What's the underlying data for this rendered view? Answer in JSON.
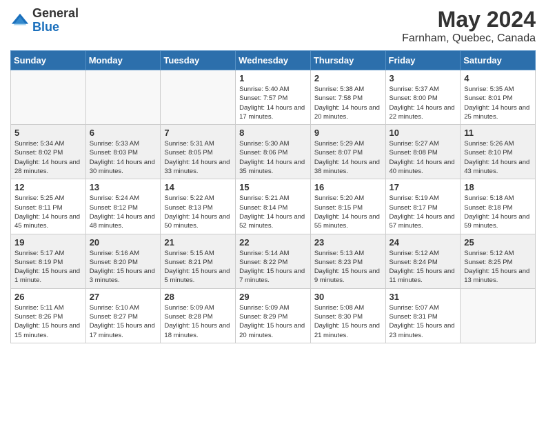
{
  "header": {
    "logo_general": "General",
    "logo_blue": "Blue",
    "title": "May 2024",
    "subtitle": "Farnham, Quebec, Canada"
  },
  "days_of_week": [
    "Sunday",
    "Monday",
    "Tuesday",
    "Wednesday",
    "Thursday",
    "Friday",
    "Saturday"
  ],
  "weeks": [
    {
      "days": [
        {
          "number": "",
          "sunrise": "",
          "sunset": "",
          "daylight": "",
          "empty": true
        },
        {
          "number": "",
          "sunrise": "",
          "sunset": "",
          "daylight": "",
          "empty": true
        },
        {
          "number": "",
          "sunrise": "",
          "sunset": "",
          "daylight": "",
          "empty": true
        },
        {
          "number": "1",
          "sunrise": "Sunrise: 5:40 AM",
          "sunset": "Sunset: 7:57 PM",
          "daylight": "Daylight: 14 hours and 17 minutes."
        },
        {
          "number": "2",
          "sunrise": "Sunrise: 5:38 AM",
          "sunset": "Sunset: 7:58 PM",
          "daylight": "Daylight: 14 hours and 20 minutes."
        },
        {
          "number": "3",
          "sunrise": "Sunrise: 5:37 AM",
          "sunset": "Sunset: 8:00 PM",
          "daylight": "Daylight: 14 hours and 22 minutes."
        },
        {
          "number": "4",
          "sunrise": "Sunrise: 5:35 AM",
          "sunset": "Sunset: 8:01 PM",
          "daylight": "Daylight: 14 hours and 25 minutes."
        }
      ]
    },
    {
      "days": [
        {
          "number": "5",
          "sunrise": "Sunrise: 5:34 AM",
          "sunset": "Sunset: 8:02 PM",
          "daylight": "Daylight: 14 hours and 28 minutes."
        },
        {
          "number": "6",
          "sunrise": "Sunrise: 5:33 AM",
          "sunset": "Sunset: 8:03 PM",
          "daylight": "Daylight: 14 hours and 30 minutes."
        },
        {
          "number": "7",
          "sunrise": "Sunrise: 5:31 AM",
          "sunset": "Sunset: 8:05 PM",
          "daylight": "Daylight: 14 hours and 33 minutes."
        },
        {
          "number": "8",
          "sunrise": "Sunrise: 5:30 AM",
          "sunset": "Sunset: 8:06 PM",
          "daylight": "Daylight: 14 hours and 35 minutes."
        },
        {
          "number": "9",
          "sunrise": "Sunrise: 5:29 AM",
          "sunset": "Sunset: 8:07 PM",
          "daylight": "Daylight: 14 hours and 38 minutes."
        },
        {
          "number": "10",
          "sunrise": "Sunrise: 5:27 AM",
          "sunset": "Sunset: 8:08 PM",
          "daylight": "Daylight: 14 hours and 40 minutes."
        },
        {
          "number": "11",
          "sunrise": "Sunrise: 5:26 AM",
          "sunset": "Sunset: 8:10 PM",
          "daylight": "Daylight: 14 hours and 43 minutes."
        }
      ]
    },
    {
      "days": [
        {
          "number": "12",
          "sunrise": "Sunrise: 5:25 AM",
          "sunset": "Sunset: 8:11 PM",
          "daylight": "Daylight: 14 hours and 45 minutes."
        },
        {
          "number": "13",
          "sunrise": "Sunrise: 5:24 AM",
          "sunset": "Sunset: 8:12 PM",
          "daylight": "Daylight: 14 hours and 48 minutes."
        },
        {
          "number": "14",
          "sunrise": "Sunrise: 5:22 AM",
          "sunset": "Sunset: 8:13 PM",
          "daylight": "Daylight: 14 hours and 50 minutes."
        },
        {
          "number": "15",
          "sunrise": "Sunrise: 5:21 AM",
          "sunset": "Sunset: 8:14 PM",
          "daylight": "Daylight: 14 hours and 52 minutes."
        },
        {
          "number": "16",
          "sunrise": "Sunrise: 5:20 AM",
          "sunset": "Sunset: 8:15 PM",
          "daylight": "Daylight: 14 hours and 55 minutes."
        },
        {
          "number": "17",
          "sunrise": "Sunrise: 5:19 AM",
          "sunset": "Sunset: 8:17 PM",
          "daylight": "Daylight: 14 hours and 57 minutes."
        },
        {
          "number": "18",
          "sunrise": "Sunrise: 5:18 AM",
          "sunset": "Sunset: 8:18 PM",
          "daylight": "Daylight: 14 hours and 59 minutes."
        }
      ]
    },
    {
      "days": [
        {
          "number": "19",
          "sunrise": "Sunrise: 5:17 AM",
          "sunset": "Sunset: 8:19 PM",
          "daylight": "Daylight: 15 hours and 1 minute."
        },
        {
          "number": "20",
          "sunrise": "Sunrise: 5:16 AM",
          "sunset": "Sunset: 8:20 PM",
          "daylight": "Daylight: 15 hours and 3 minutes."
        },
        {
          "number": "21",
          "sunrise": "Sunrise: 5:15 AM",
          "sunset": "Sunset: 8:21 PM",
          "daylight": "Daylight: 15 hours and 5 minutes."
        },
        {
          "number": "22",
          "sunrise": "Sunrise: 5:14 AM",
          "sunset": "Sunset: 8:22 PM",
          "daylight": "Daylight: 15 hours and 7 minutes."
        },
        {
          "number": "23",
          "sunrise": "Sunrise: 5:13 AM",
          "sunset": "Sunset: 8:23 PM",
          "daylight": "Daylight: 15 hours and 9 minutes."
        },
        {
          "number": "24",
          "sunrise": "Sunrise: 5:12 AM",
          "sunset": "Sunset: 8:24 PM",
          "daylight": "Daylight: 15 hours and 11 minutes."
        },
        {
          "number": "25",
          "sunrise": "Sunrise: 5:12 AM",
          "sunset": "Sunset: 8:25 PM",
          "daylight": "Daylight: 15 hours and 13 minutes."
        }
      ]
    },
    {
      "days": [
        {
          "number": "26",
          "sunrise": "Sunrise: 5:11 AM",
          "sunset": "Sunset: 8:26 PM",
          "daylight": "Daylight: 15 hours and 15 minutes."
        },
        {
          "number": "27",
          "sunrise": "Sunrise: 5:10 AM",
          "sunset": "Sunset: 8:27 PM",
          "daylight": "Daylight: 15 hours and 17 minutes."
        },
        {
          "number": "28",
          "sunrise": "Sunrise: 5:09 AM",
          "sunset": "Sunset: 8:28 PM",
          "daylight": "Daylight: 15 hours and 18 minutes."
        },
        {
          "number": "29",
          "sunrise": "Sunrise: 5:09 AM",
          "sunset": "Sunset: 8:29 PM",
          "daylight": "Daylight: 15 hours and 20 minutes."
        },
        {
          "number": "30",
          "sunrise": "Sunrise: 5:08 AM",
          "sunset": "Sunset: 8:30 PM",
          "daylight": "Daylight: 15 hours and 21 minutes."
        },
        {
          "number": "31",
          "sunrise": "Sunrise: 5:07 AM",
          "sunset": "Sunset: 8:31 PM",
          "daylight": "Daylight: 15 hours and 23 minutes."
        },
        {
          "number": "",
          "sunrise": "",
          "sunset": "",
          "daylight": "",
          "empty": true
        }
      ]
    }
  ]
}
